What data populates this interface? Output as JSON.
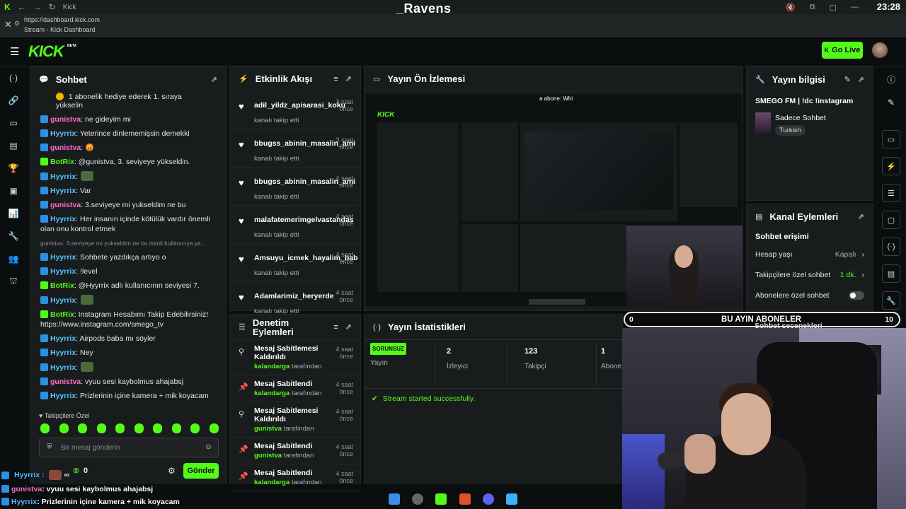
{
  "browser": {
    "tab_title": "Kick",
    "url": "https://dashboard.kick.com",
    "page_title": "Stream - Kick Dashboard"
  },
  "overlay": {
    "streamer_name": "_Ravens",
    "clock": "23:28"
  },
  "header": {
    "logo": "KICK",
    "logo_tag": "BETA",
    "go_live": "Go Live"
  },
  "chat": {
    "title": "Sohbet",
    "pinned": "1 abonelik hediye ederek 1. sıraya yükselin",
    "messages": [
      {
        "user": "gunistva",
        "color": "pink",
        "text": ": ne gideyim mi"
      },
      {
        "user": "Hyyrrix",
        "color": "blue",
        "text": ": Yeterince dinlememişsin demekki"
      },
      {
        "user": "gunistva",
        "color": "pink",
        "text": ": 😡"
      },
      {
        "user": "BotRix",
        "color": "green",
        "text": ": @gunistva, 3. seviyeye yükseldin."
      },
      {
        "user": "Hyyrrix",
        "color": "blue",
        "text": ":"
      },
      {
        "user": "Hyyrrix",
        "color": "blue",
        "text": ": Var"
      },
      {
        "user": "gunistva",
        "color": "pink",
        "text": ": 3.seviyeye mi yukseldim ne bu"
      },
      {
        "user": "Hyyrrix",
        "color": "blue",
        "text": ": Her insanın içinde kötülük vardır önemli olan onu kontrol etmek"
      },
      {
        "user": "Hyyrrix",
        "color": "blue",
        "text": ": Sohbete yazdıkça artıyo o"
      },
      {
        "user": "Hyyrrix",
        "color": "blue",
        "text": ": !level"
      },
      {
        "user": "BotRix",
        "color": "green",
        "text": ": @Hyyrrix adlı kullanıcının seviyesi 7."
      },
      {
        "user": "Hyyrrix",
        "color": "blue",
        "text": ":"
      },
      {
        "user": "BotRix",
        "color": "green",
        "text": ": Instagram Hesabımı Takip Edebilirsiniz! https://www.instagram.com/smego_tv"
      },
      {
        "user": "Hyyrrix",
        "color": "blue",
        "text": ": Airpods baba mı söyler"
      },
      {
        "user": "Hyyrrix",
        "color": "blue",
        "text": ": Ney"
      },
      {
        "user": "Hyyrrix",
        "color": "blue",
        "text": ":"
      },
      {
        "user": "gunistva",
        "color": "pink",
        "text": ": vyuu sesi kaybolmus ahajabsj"
      },
      {
        "user": "Hyyrrix",
        "color": "blue",
        "text": ": Prizlerinin içine kamera + mik koyacam"
      }
    ],
    "reply_hint": "gunistva: 3.seviyeye mi yukseldim ne bu isimli kullanıcıya ya...",
    "followers_only": "Takipçilere Özel",
    "input_placeholder": "Bir mesaj gönderin",
    "points": "0",
    "send": "Gönder"
  },
  "activity": {
    "title": "Etkinlik Akışı",
    "items": [
      {
        "name": "adil_yildz_apisarasi_koku",
        "sub": "kanalı takip etti",
        "time": "3 saat önce"
      },
      {
        "name": "bbugss_abinin_masalin_ami",
        "sub": "kanalı takip etti",
        "time": "3 saat önce"
      },
      {
        "name": "bbugss_abinin_masalin_ami",
        "sub": "kanalı takip etti",
        "time": "4 saat önce"
      },
      {
        "name": "malafatemerimgelvastandas",
        "sub": "kanalı takip etti",
        "time": "4 saat önce"
      },
      {
        "name": "Amsuyu_icmek_hayalim_bab",
        "sub": "kanalı takip etti",
        "time": "4 saat önce"
      },
      {
        "name": "Adamlarimiz_heryerde",
        "sub": "kanalı takip etti",
        "time": "4 saat önce"
      }
    ]
  },
  "moderation": {
    "title": "Denetim Eylemleri",
    "items": [
      {
        "action": "Mesaj Sabitlemesi Kaldırıldı",
        "user": "kalandarga",
        "by": "tarafından",
        "time": "4 saat önce"
      },
      {
        "action": "Mesaj Sabitlendi",
        "user": "kalandarga",
        "by": "tarafından",
        "time": "4 saat önce"
      },
      {
        "action": "Mesaj Sabitlemesi Kaldırıldı",
        "user": "gunistva",
        "by": "tarafından",
        "time": "4 saat önce"
      },
      {
        "action": "Mesaj Sabitlendi",
        "user": "gunistva",
        "by": "tarafından",
        "time": "4 saat önce"
      },
      {
        "action": "Mesaj Sabitlendi",
        "user": "kalandarga",
        "by": "tarafından",
        "time": "4 saat önce"
      }
    ]
  },
  "preview": {
    "title": "Yayın Ön İzlemesi",
    "ticker": "a abone: Whi"
  },
  "stats": {
    "title": "Yayın İstatistikleri",
    "status_badge": "SORUNSUZ",
    "status_label": "Yayın",
    "viewers_value": "2",
    "viewers_label": "İzleyici",
    "followers_value": "123",
    "followers_label": "Takipçi",
    "subs_value": "1",
    "subs_label": "Abone",
    "log": "Stream started successfully."
  },
  "stream_info": {
    "title": "Yayın bilgisi",
    "stream_title": "SMEGO FM | !dc !instagram",
    "category": "Sadece Sohbet",
    "tag": "Turkish"
  },
  "channel_actions": {
    "title": "Kanal Eylemleri",
    "section": "Sohbet erişimi",
    "rows": [
      {
        "label": "Hesap yaşı",
        "value": "Kapalı"
      },
      {
        "label": "Takipçilere özel sohbet",
        "value": "1 dk."
      },
      {
        "label": "Abonelere özel sohbet",
        "value": ""
      }
    ],
    "partial": "Sohbet seçenekleri"
  },
  "sub_goal": {
    "left": "0",
    "title": "BU AYIN ABONELER",
    "right": "10"
  },
  "bottom_overlay": {
    "line1_user": "Hyyrrix :",
    "line1_extra": "0",
    "line2_user": "gunistva",
    "line2_text": ": vyuu sesi kaybolmus ahajabsj",
    "line3_user": "Hyyrrix",
    "line3_text": ": Prizlerinin içine kamera + mik koyacam"
  },
  "colors": {
    "accent": "#53fc18",
    "panel": "#191c1d",
    "bg": "#0b0e0f",
    "user_blue": "#53c4ff",
    "user_pink": "#ff6fc8"
  }
}
